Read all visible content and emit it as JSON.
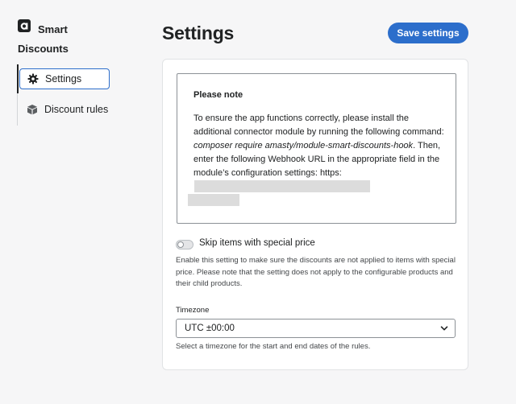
{
  "brand": {
    "name": "Smart Discounts"
  },
  "sidebar": {
    "items": [
      {
        "label": "Settings",
        "icon": "gear-icon",
        "active": true
      },
      {
        "label": "Discount rules",
        "icon": "box-icon",
        "active": false
      }
    ]
  },
  "header": {
    "title": "Settings",
    "save_label": "Save settings"
  },
  "note": {
    "title": "Please note",
    "text_before": "To ensure the app functions correctly, please install the additional connector module by running the following command: ",
    "command": "composer require amasty/module-smart-discounts-hook",
    "text_after": ". Then, enter the following Webhook URL in the appropriate field in the module’s configuration settings: https:"
  },
  "skip_special_price": {
    "label": "Skip items with special price",
    "enabled": false,
    "help": "Enable this setting to make sure the discounts are not applied to items with special price. Please note that the setting does not apply to the configurable products and their child products."
  },
  "timezone": {
    "label": "Timezone",
    "value": "UTC ±00:00",
    "help": "Select a timezone for the start and end dates of the rules."
  },
  "colors": {
    "accent": "#2c6ecb",
    "background": "#f6f6f7",
    "card": "#ffffff",
    "text": "#202223"
  }
}
